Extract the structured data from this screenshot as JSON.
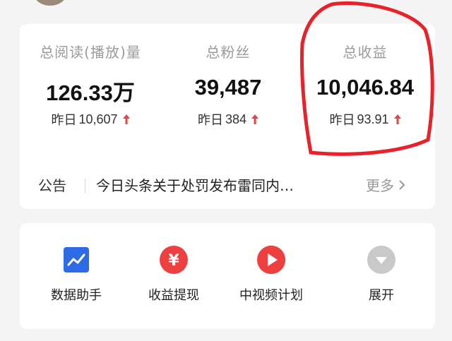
{
  "stats": [
    {
      "label": "总阅读(播放)量",
      "value": "126.33万",
      "sub_prefix": "昨日",
      "sub_value": "10,607"
    },
    {
      "label": "总粉丝",
      "value": "39,487",
      "sub_prefix": "昨日",
      "sub_value": "384"
    },
    {
      "label": "总收益",
      "value": "10,046.84",
      "sub_prefix": "昨日",
      "sub_value": "93.91"
    }
  ],
  "notice": {
    "label": "公告",
    "text": "今日头条关于处罚发布雷同内…",
    "more_label": "更多"
  },
  "tools": [
    {
      "label": "数据助手",
      "icon": "trend-chart-icon"
    },
    {
      "label": "收益提现",
      "icon": "yuan-icon"
    },
    {
      "label": "中视频计划",
      "icon": "play-video-icon"
    },
    {
      "label": "展开",
      "icon": "expand-down-icon"
    }
  ],
  "colors": {
    "accent_red": "#ee4040",
    "highlight_ring": "#e8222a",
    "data_blue": "#2d6be6",
    "muted_gray": "#c9c9c9"
  }
}
